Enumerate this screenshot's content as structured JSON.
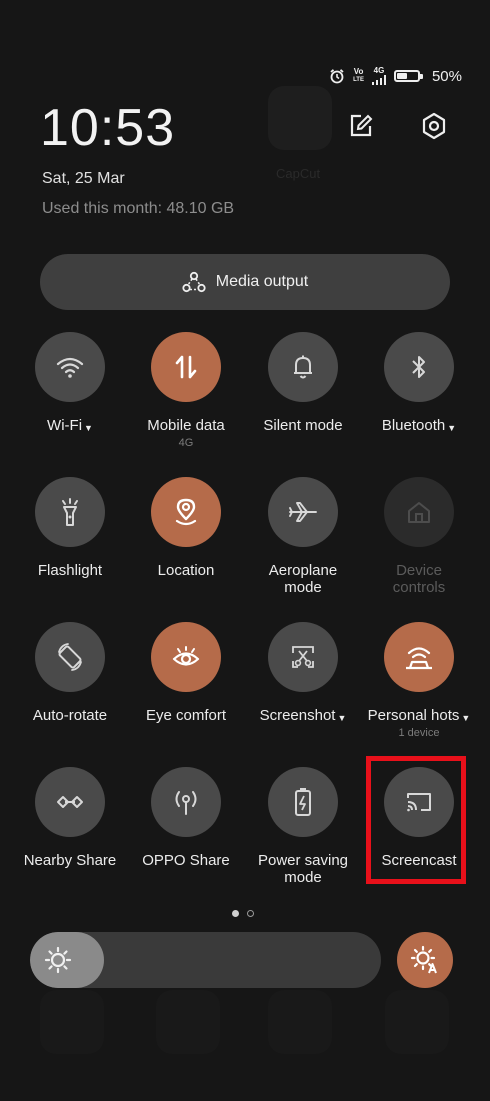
{
  "status": {
    "volte_top": "Vo",
    "volte_bottom": "LTE",
    "net_type": "4G",
    "battery_level": 0.5,
    "battery_text": "50%"
  },
  "clock": "10:53",
  "date": "Sat, 25 Mar",
  "usage": "Used this month: 48.10 GB",
  "background_app_label": "CapCut",
  "media_output": "Media output",
  "tiles": {
    "wifi": {
      "label": "Wi-Fi",
      "has_caret": true,
      "state": "off",
      "icon": "wifi-icon"
    },
    "mobile_data": {
      "label": "Mobile data",
      "sub": "4G",
      "state": "on",
      "icon": "up-down-arrows-icon"
    },
    "silent_mode": {
      "label": "Silent mode",
      "state": "off",
      "icon": "bell-icon"
    },
    "bluetooth": {
      "label": "Bluetooth",
      "has_caret": true,
      "state": "off",
      "icon": "bluetooth-icon"
    },
    "flashlight": {
      "label": "Flashlight",
      "state": "off",
      "icon": "flashlight-icon"
    },
    "location": {
      "label": "Location",
      "state": "on",
      "icon": "location-pin-icon"
    },
    "aeroplane": {
      "label_1": "Aeroplane",
      "label_2": "mode",
      "state": "off",
      "icon": "airplane-icon"
    },
    "device_controls": {
      "label_1": "Device",
      "label_2": "controls",
      "state": "disabled",
      "icon": "home-icon"
    },
    "auto_rotate": {
      "label": "Auto-rotate",
      "state": "off",
      "icon": "rotate-icon"
    },
    "eye_comfort": {
      "label": "Eye comfort",
      "state": "on",
      "icon": "eye-icon"
    },
    "screenshot": {
      "label": "Screenshot",
      "has_caret": true,
      "state": "off",
      "icon": "scissors-icon"
    },
    "hotspot": {
      "label": "Personal hots",
      "has_caret": true,
      "sub": "1 device",
      "state": "on",
      "icon": "hotspot-icon"
    },
    "nearby_share": {
      "label": "Nearby Share",
      "state": "off",
      "icon": "nearby-share-icon"
    },
    "oppo_share": {
      "label": "OPPO Share",
      "state": "off",
      "icon": "broadcast-icon"
    },
    "power_saving": {
      "label_1": "Power saving",
      "label_2": "mode",
      "state": "off",
      "icon": "battery-bolt-icon"
    },
    "screencast": {
      "label": "Screencast",
      "state": "off",
      "icon": "cast-icon",
      "highlighted": true
    }
  },
  "page_indicator": {
    "pages": 2,
    "current": 1
  },
  "brightness": {
    "level": 0.21
  },
  "colors": {
    "accent_on": "#b56b4a",
    "tile_off": "#4a4a4a",
    "highlight_box": "#e8101a",
    "background": "#161616"
  }
}
